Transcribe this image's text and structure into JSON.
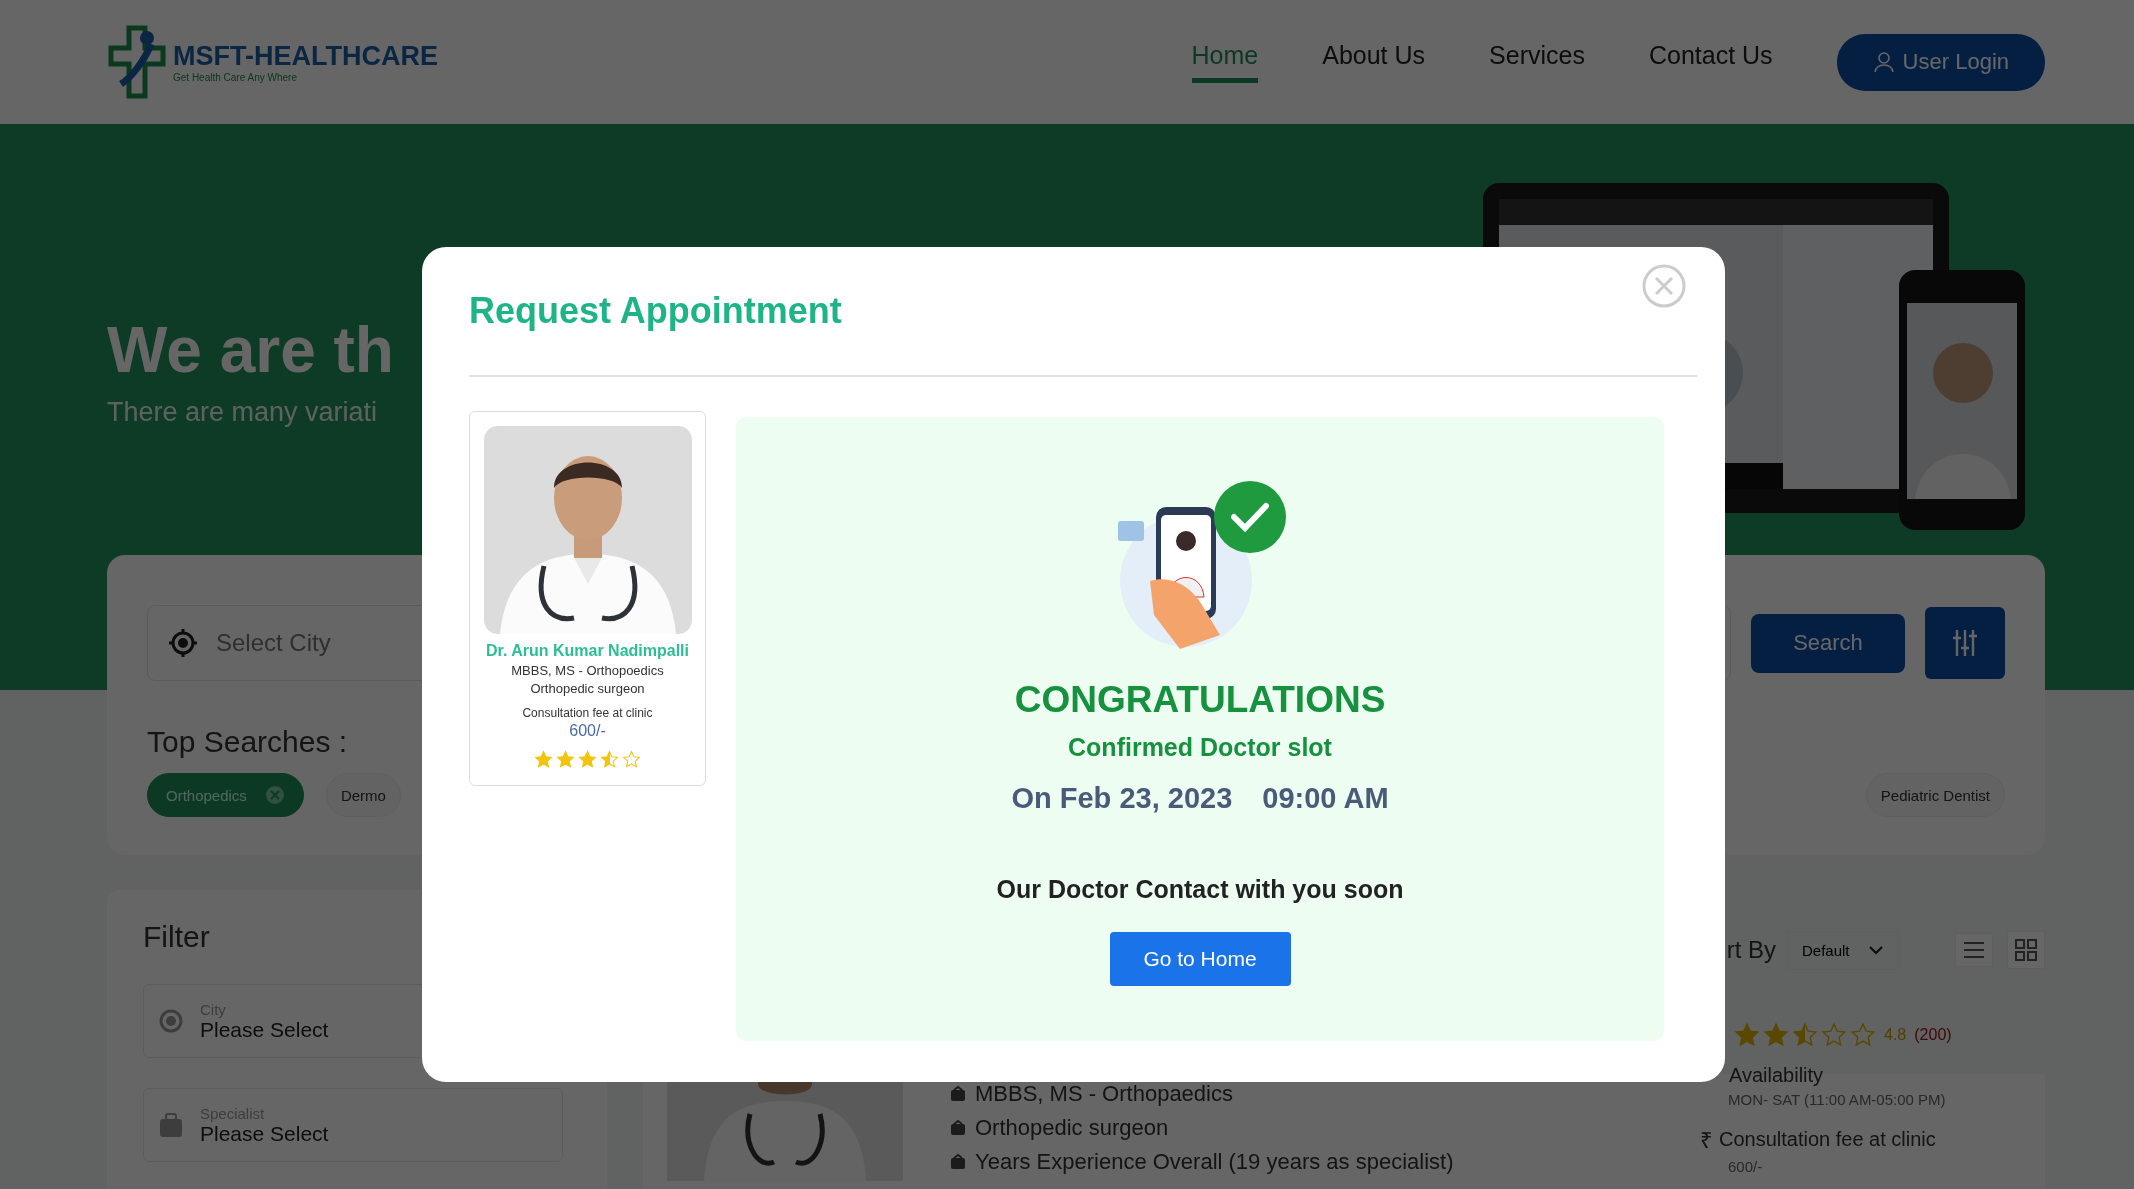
{
  "header": {
    "logo": {
      "name": "MSFT-HEALTHCARE",
      "tagline": "Get Health Care Any Where"
    },
    "nav": [
      {
        "label": "Home",
        "selected": true
      },
      {
        "label": "About Us",
        "selected": false
      },
      {
        "label": "Services",
        "selected": false
      },
      {
        "label": "Contact Us",
        "selected": false
      }
    ],
    "login_button": "User Login"
  },
  "hero": {
    "heading": "We are th",
    "subheading": "There are many variati"
  },
  "search": {
    "city_placeholder": "Select City",
    "search_button": "Search",
    "top_searches_label": "Top Searches :",
    "chips": [
      {
        "label": "Orthopedics",
        "selected": true
      },
      {
        "label": "Dermo",
        "selected": false
      },
      {
        "label": "Pediatric Dentist",
        "selected": false
      }
    ]
  },
  "filter": {
    "title": "Filter",
    "fields": [
      {
        "label": "City",
        "value": "Please Select",
        "kind": "location"
      },
      {
        "label": "Specialist",
        "value": "Please Select",
        "kind": "specialist"
      }
    ]
  },
  "results": {
    "sort_label": "rt By",
    "sort_value": "Default",
    "doctor": {
      "degree": "MBBS, MS -  Orthopaedics",
      "role": "Orthopedic surgeon",
      "experience": "Years Experience Overall  (19 years as specialist)",
      "stars": 2.5,
      "rating": "4.8",
      "reviews": "(200)",
      "availability_label": "Availability",
      "availability": "MON- SAT (11:00 AM-05:00 PM)",
      "currency": "₹",
      "fee_label": "Consultation fee at clinic",
      "fee": "600/-"
    }
  },
  "modal": {
    "title": "Request Appointment",
    "doctor": {
      "name": "Dr. Arun Kumar Nadimpalli",
      "degree": "MBBS, MS - Orthopoedics",
      "role": "Orthopedic surgeon",
      "fee_label": "Consultation fee at clinic",
      "fee": "600/-",
      "stars": 3.5
    },
    "confirmation": {
      "heading": "CONGRATULATIONS",
      "subheading": "Confirmed Doctor slot",
      "date": "On Feb 23, 2023",
      "time": "09:00 AM",
      "message": "Our Doctor Contact with you soon",
      "button": "Go to Home"
    }
  }
}
